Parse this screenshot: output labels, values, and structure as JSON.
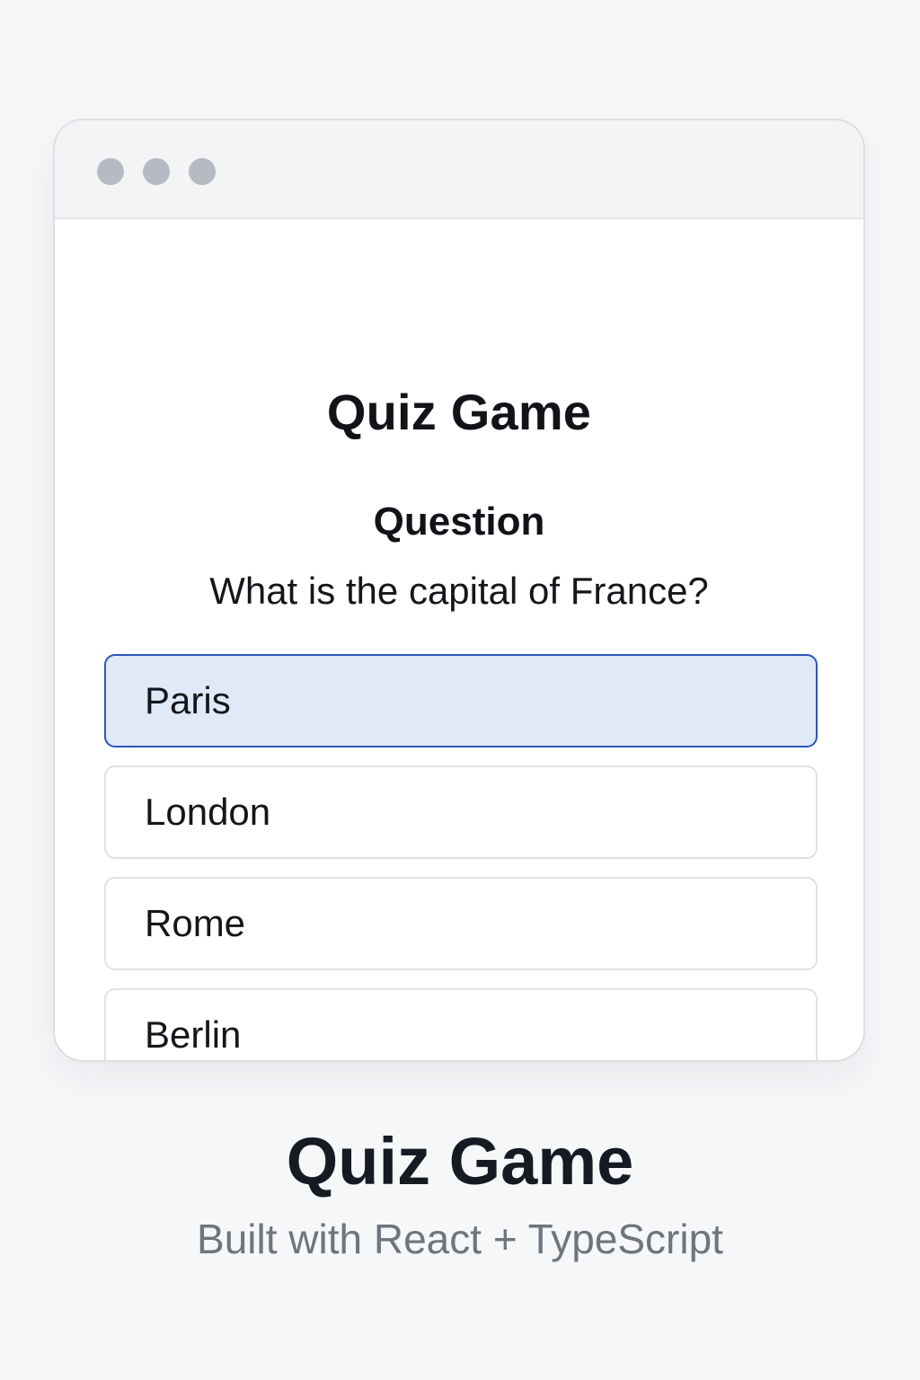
{
  "window": {
    "controls": [
      "window-dot",
      "window-dot",
      "window-dot"
    ]
  },
  "app": {
    "title": "Quiz Game",
    "question_heading": "Question",
    "question_text": "What is the capital of France?",
    "options": [
      {
        "label": "Paris",
        "selected": true
      },
      {
        "label": "London",
        "selected": false
      },
      {
        "label": "Rome",
        "selected": false
      },
      {
        "label": "Berlin",
        "selected": false
      }
    ]
  },
  "footer": {
    "title": "Quiz Game",
    "subtitle": "Built with React + TypeScript"
  },
  "colors": {
    "background": "#f6f7f9",
    "selected_fill": "#dfe9f8",
    "selected_border": "#2d55b8",
    "subtitle_text": "#6f747d"
  }
}
